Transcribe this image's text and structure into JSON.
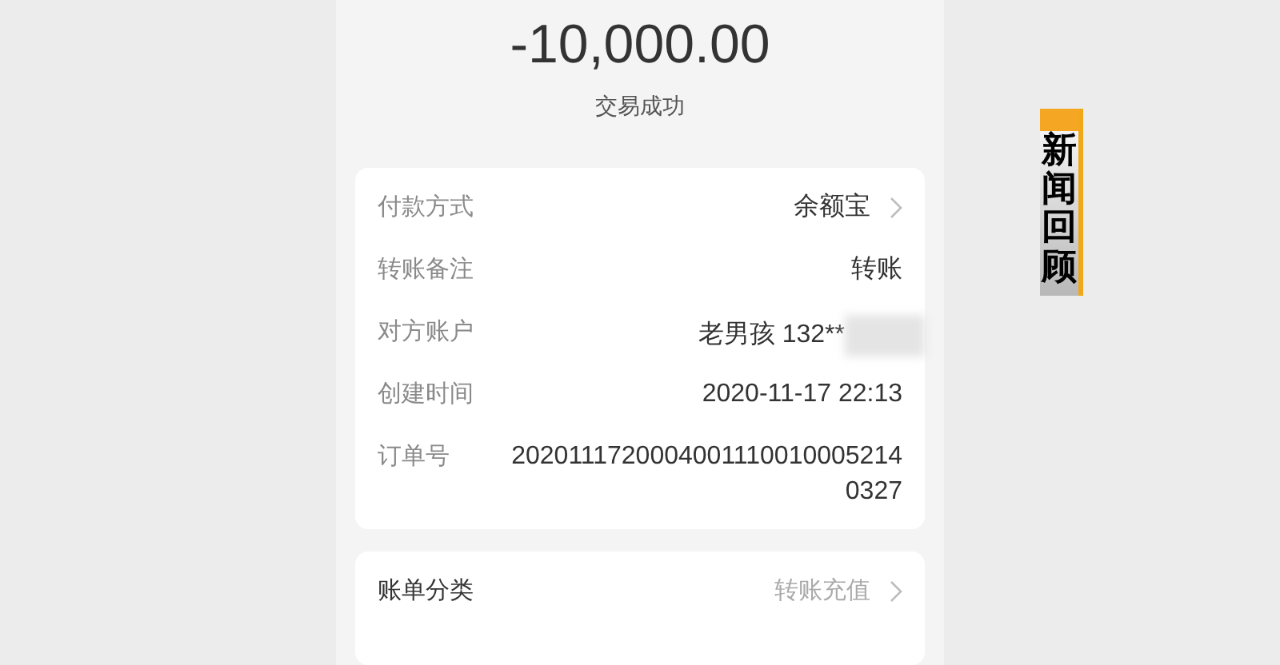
{
  "amount": "-10,000.00",
  "status": "交易成功",
  "details": [
    {
      "label": "付款方式",
      "value": "余额宝",
      "link": true,
      "redacted": false
    },
    {
      "label": "转账备注",
      "value": "转账",
      "link": false,
      "redacted": false
    },
    {
      "label": "对方账户",
      "value": "老男孩 132**",
      "link": false,
      "redacted": true
    },
    {
      "label": "创建时间",
      "value": "2020-11-17 22:13",
      "link": false,
      "redacted": false
    },
    {
      "label": "订单号",
      "value": "20201117200040011100100052140327",
      "link": false,
      "redacted": false
    }
  ],
  "category": {
    "label": "账单分类",
    "value": "转账充值",
    "link": true
  },
  "caption": "新闻回顾"
}
